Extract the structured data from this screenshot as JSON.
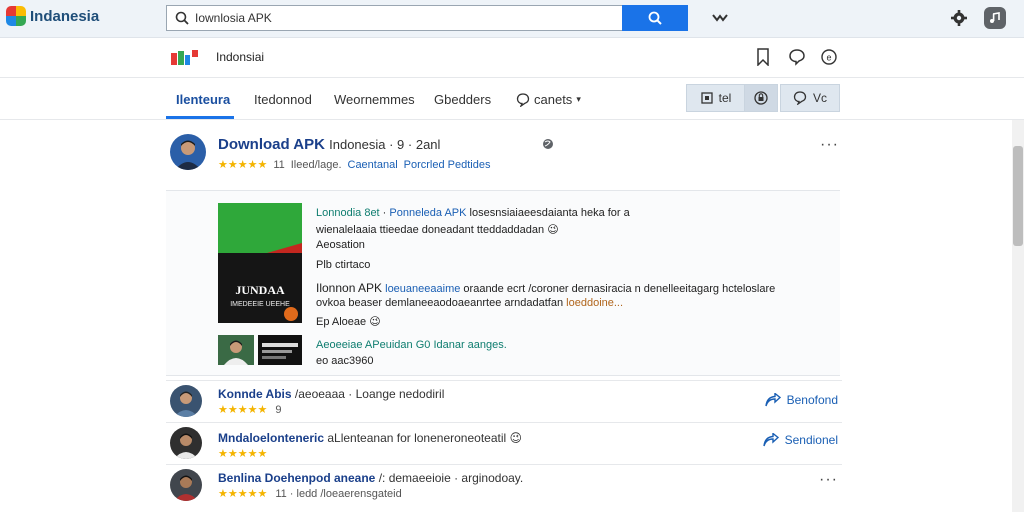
{
  "app": {
    "name": "Indanesia"
  },
  "search": {
    "value": "Iownlosia APK"
  },
  "channel": {
    "name": "Indonsiai"
  },
  "tabs": [
    {
      "label": "Ilenteura"
    },
    {
      "label": "Itedonnod"
    },
    {
      "label": "Weornemmes"
    },
    {
      "label": "Gbedders"
    },
    {
      "label": "canets"
    }
  ],
  "toolbar": {
    "seg1": "tel",
    "seg3": "Vc"
  },
  "post": {
    "title": "Download APK",
    "title_rest": "Indonesia · 9 · 2anl",
    "rating_count": "11",
    "meta1": "Ileed/lage.",
    "meta2": "Caentanal",
    "meta3": "Porcrled Pedtides",
    "p1_head": "Lonnodia 8et",
    "p1_link": "Ponneleda APK",
    "p1_rest": "losesnsiaiaeesdaianta heka for a",
    "p1_line2": "wienalelaaia ttieedae doneadant tteddaddadan 😉",
    "p1_line3": "Aeosation",
    "p1_line4": "Plb ctirtaco",
    "p2_head": "Ilonnon APK",
    "p2_link": "loeuaneeaaime",
    "p2_rest": "oraande ecrt /coroner dernasiracia n denelleeitagarg hcteloslare",
    "p2_line2": "ovkoa beaser demlaneeaodoaeanrtee arndadatfan",
    "p2_line2_link": "loeddoine...",
    "p2_line3": "Ep Aloeae 😉",
    "p3_link": "Aeoeeiae APeuidan G0",
    "p3_rest": "Idanar aanges.",
    "p3_sub": "eo aac3960",
    "thumb_title": "JUNDAA",
    "thumb_sub": "IMEDEEIE UEEHE"
  },
  "rows": [
    {
      "title": "Konnde Abis",
      "title_rest": "/aeoeaaa · Loange nedodiril",
      "count": "9",
      "action": "Benofond"
    },
    {
      "title": "Mndaloelonteneric",
      "title_rest": "aLlenteanan for loneneroneoteatil 😉",
      "count": "",
      "action": "Sendionel"
    },
    {
      "title": "Benlina Doehenpod aneane",
      "title_rest": "/: demaeeioie · arginodoay.",
      "count": "11 · ledd /loeaerensgateid",
      "action": ""
    }
  ],
  "colors": {
    "accent": "#1a73e8",
    "star": "#f4b400",
    "link": "#1a5fb4"
  }
}
